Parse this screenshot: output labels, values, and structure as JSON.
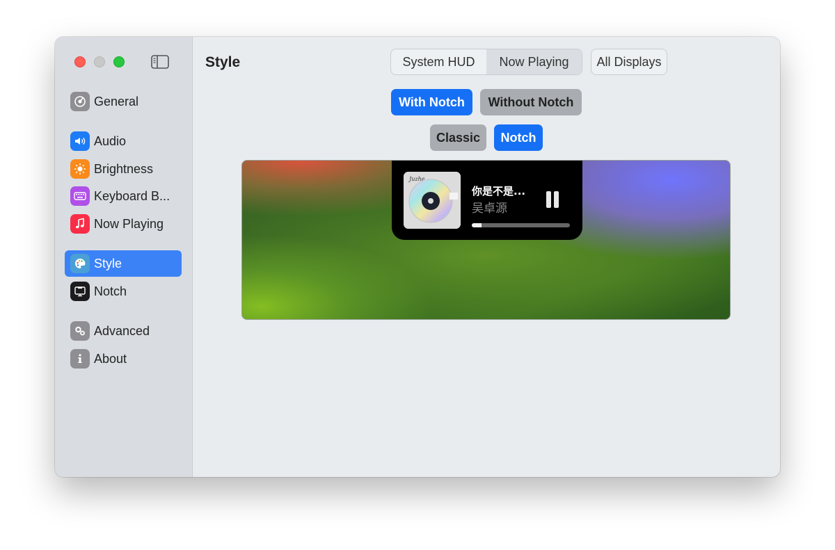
{
  "window": {
    "colors": {
      "accent": "#1670f5",
      "sidebar_selection": "#3b82f6"
    }
  },
  "sidebar": {
    "items": [
      {
        "label": "General",
        "icon": "gear-icon",
        "color": "#8e8e93"
      },
      {
        "label": "Audio",
        "icon": "speaker-icon",
        "color": "#1d7bf5"
      },
      {
        "label": "Brightness",
        "icon": "sun-icon",
        "color": "#f98a1b"
      },
      {
        "label": "Keyboard B...",
        "icon": "keyboard-icon",
        "color": "#b050e8"
      },
      {
        "label": "Now Playing",
        "icon": "music-note-icon",
        "color": "#fa2d48"
      },
      {
        "label": "Style",
        "icon": "palette-icon",
        "color": "#4a9fd6",
        "selected": true
      },
      {
        "label": "Notch",
        "icon": "display-icon",
        "color": "#1c1c1e"
      },
      {
        "label": "Advanced",
        "icon": "gears-icon",
        "color": "#8e8e93"
      },
      {
        "label": "About",
        "icon": "info-icon",
        "color": "#8e8e93"
      }
    ]
  },
  "main": {
    "title": "Style",
    "segment": {
      "options": [
        "System HUD",
        "Now Playing"
      ],
      "selected": "Now Playing"
    },
    "displays_label": "All Displays",
    "notch_options": {
      "with": "With Notch",
      "without": "Without Notch",
      "selected": "With Notch"
    },
    "style_options": {
      "classic": "Classic",
      "notch": "Notch",
      "selected": "Notch"
    }
  },
  "preview": {
    "song_title": "你是不是...",
    "artist": "吴卓源",
    "progress": 0.1,
    "playing": true
  }
}
